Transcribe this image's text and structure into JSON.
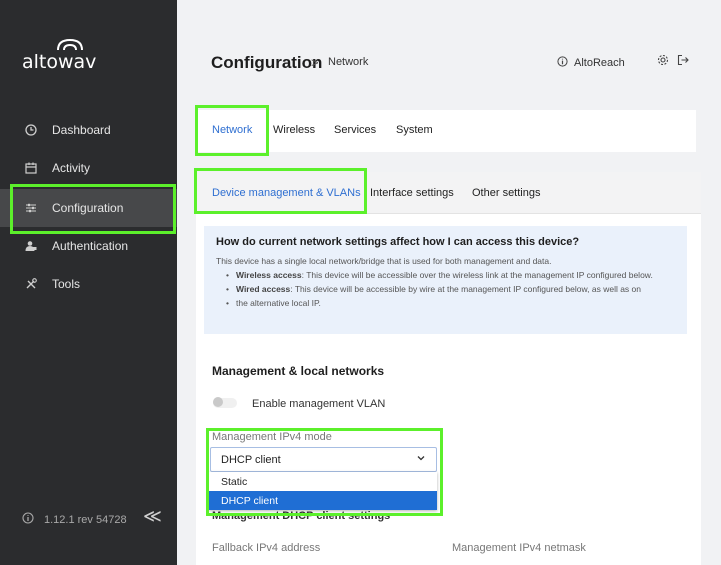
{
  "brand": {
    "logo_text": "altowav"
  },
  "sidebar": {
    "items": [
      {
        "label": "Dashboard",
        "icon": "clock-icon"
      },
      {
        "label": "Activity",
        "icon": "calendar-icon"
      },
      {
        "label": "Configuration",
        "icon": "sliders-icon",
        "active": true
      },
      {
        "label": "Authentication",
        "icon": "user-lock-icon"
      },
      {
        "label": "Tools",
        "icon": "tools-icon"
      }
    ],
    "version": "1.12.1 rev 54728",
    "collapse_symbol": "≪"
  },
  "header": {
    "title": "Configuration",
    "separator": ">",
    "subtitle": "Network",
    "user": "AltoReach"
  },
  "tabs": [
    {
      "label": "Network",
      "active": true
    },
    {
      "label": "Wireless"
    },
    {
      "label": "Services"
    },
    {
      "label": "System"
    }
  ],
  "subtabs": [
    {
      "label": "Device management & VLANs",
      "active": true
    },
    {
      "label": "Interface settings"
    },
    {
      "label": "Other settings"
    }
  ],
  "info": {
    "title": "How do current network settings affect how I can access this device?",
    "line": "This device has a single local network/bridge that is used for both management and data.",
    "bullet1_bold": "Wireless access",
    "bullet1_text": ": This device will be accessible over the wireless link at the management IP configured below.",
    "bullet2_bold": "Wired access",
    "bullet2_text": ": This device will be accessible by wire at the management IP configured below, as well as on",
    "bullet2_cont": "the alternative local IP."
  },
  "management": {
    "section_title": "Management & local networks",
    "vlan_toggle_label": "Enable management VLAN",
    "vlan_enabled": false,
    "mode_label": "Management IPv4 mode",
    "mode_value": "DHCP client",
    "options": [
      "Static",
      "DHCP client"
    ],
    "selected_option": "DHCP client",
    "dhcp_section_title": "Management DHCP client settings",
    "fallback_label": "Fallback IPv4 address",
    "netmask_label": "Management IPv4 netmask"
  },
  "colors": {
    "accent": "#2f6fd1",
    "highlight": "#5cf02b",
    "sidebar": "#2b2c2e"
  }
}
